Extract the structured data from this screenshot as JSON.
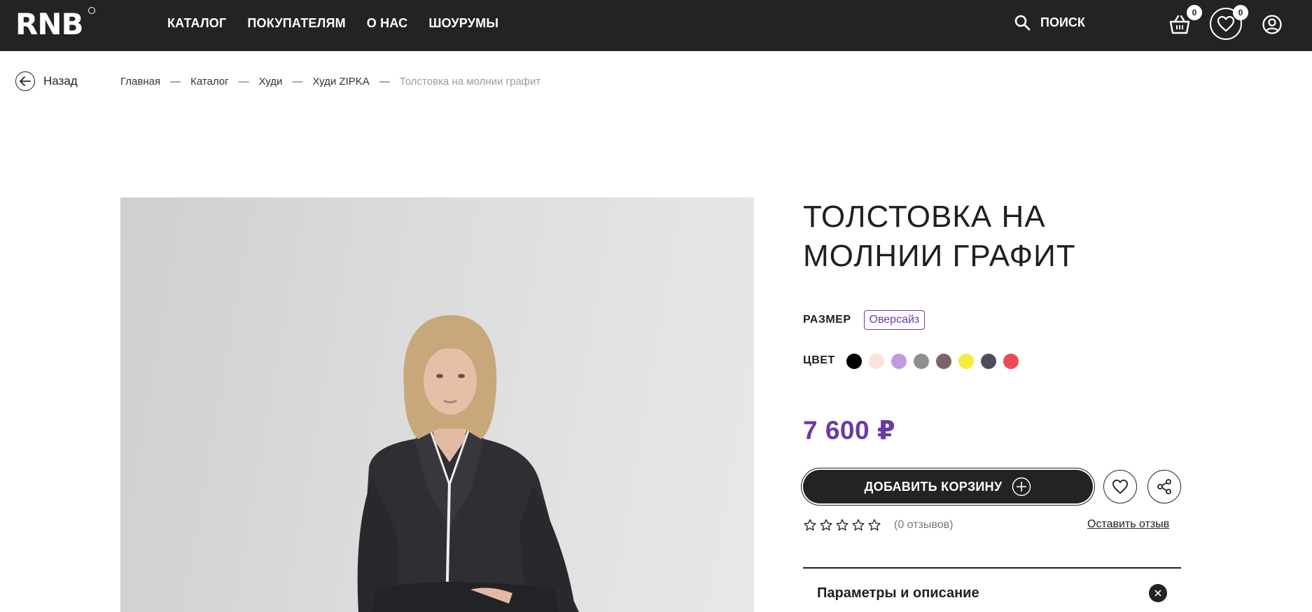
{
  "header": {
    "logo": "RNB",
    "nav": [
      "КАТАЛОГ",
      "ПОКУПАТЕЛЯМ",
      "О НАС",
      "ШОУРУМЫ"
    ],
    "search_label": "ПОИСК",
    "cart_count": "0",
    "favorites_count": "0",
    "icons": {
      "search": "search-icon",
      "cart": "basket-icon",
      "favorites": "heart-icon",
      "account": "user-icon"
    }
  },
  "breadcrumb": {
    "back_label": "Назад",
    "items": [
      "Главная",
      "Каталог",
      "Худи",
      "Худи ZIPKA"
    ],
    "current": "Толстовка на молнии графит"
  },
  "product": {
    "title": "ТОЛСТОВКА НА МОЛНИИ ГРАФИТ",
    "size_label": "РАЗМЕР",
    "size_value": "Оверсайз",
    "color_label": "ЦВЕТ",
    "colors": [
      "#000000",
      "#f8e4da",
      "#c09ae2",
      "#8f8f8f",
      "#7d6468",
      "#f4ec3a",
      "#4d4d5e",
      "#ea4b56"
    ],
    "price": "7 600 ₽",
    "add_to_cart_label": "ДОБАВИТЬ КОРЗИНУ",
    "rating": 0,
    "reviews_count": "(0 отзывов)",
    "leave_review_label": "Оставить отзыв",
    "params_label": "Параметры и описание"
  },
  "colors": {
    "header_bg": "#232323",
    "accent": "#6a3aa8"
  }
}
